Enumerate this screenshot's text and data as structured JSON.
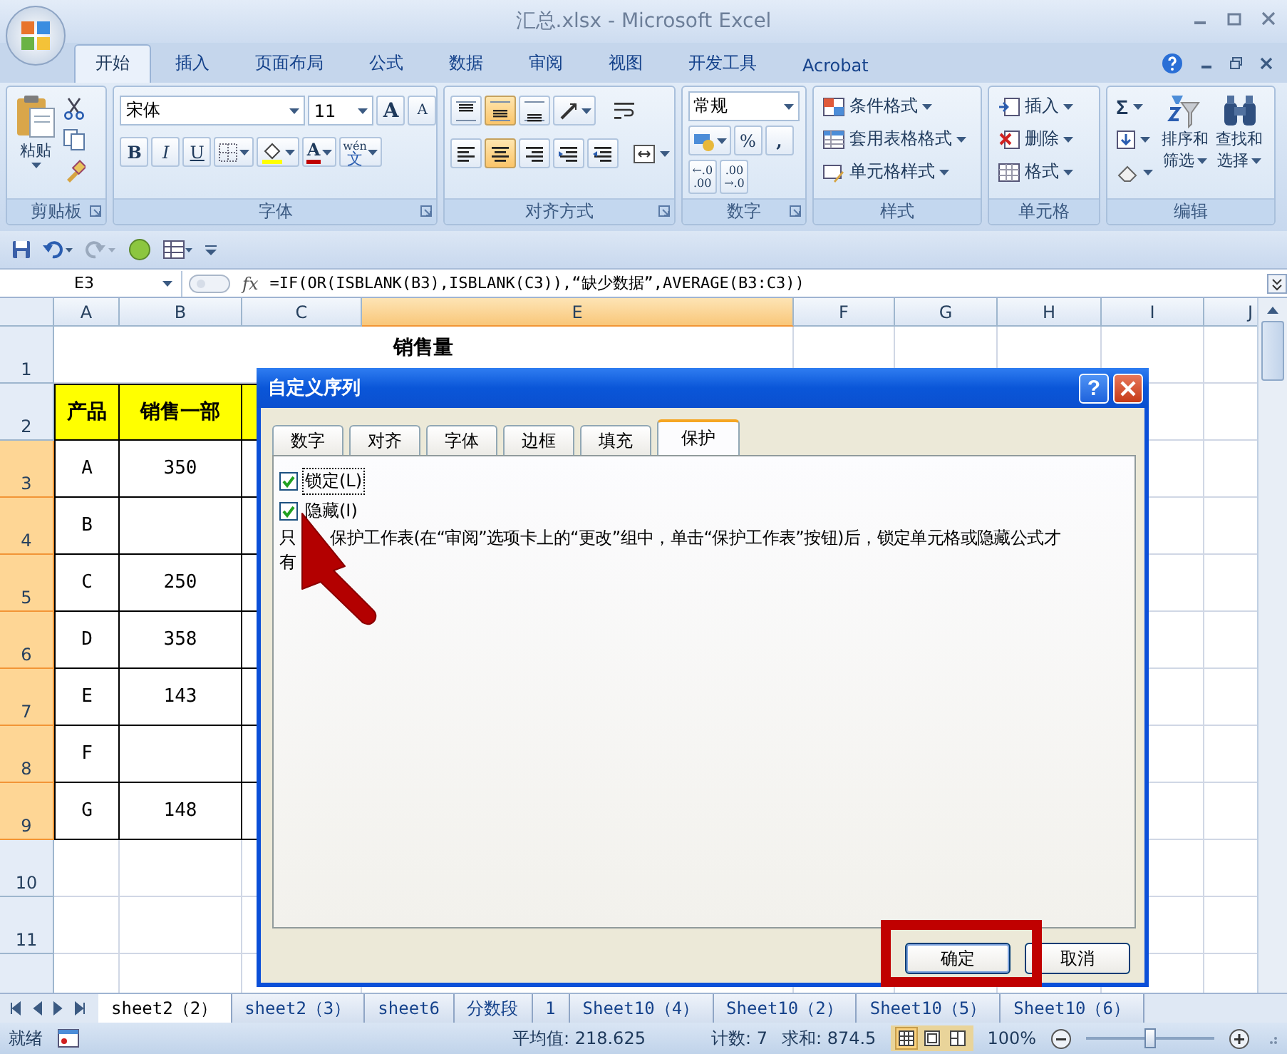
{
  "window": {
    "title": "汇总.xlsx - Microsoft Excel"
  },
  "ribbon": {
    "tabs": [
      {
        "label": "开始",
        "selected": true
      },
      {
        "label": "插入",
        "selected": false
      },
      {
        "label": "页面布局",
        "selected": false
      },
      {
        "label": "公式",
        "selected": false
      },
      {
        "label": "数据",
        "selected": false
      },
      {
        "label": "审阅",
        "selected": false
      },
      {
        "label": "视图",
        "selected": false
      },
      {
        "label": "开发工具",
        "selected": false
      },
      {
        "label": "Acrobat",
        "selected": false
      }
    ],
    "groups": [
      {
        "kind": "clipboard",
        "label": "剪贴板",
        "paste": "粘贴"
      },
      {
        "kind": "font",
        "label": "字体",
        "font": "宋体",
        "size": "11",
        "grow": "A",
        "shrink": "A",
        "bold": "B",
        "italic": "I",
        "underline": "U",
        "font_color": "A",
        "phonetic": [
          "wén",
          "文"
        ]
      },
      {
        "kind": "alignment",
        "label": "对齐方式",
        "vertical": [
          {
            "selected": false
          },
          {
            "selected": true
          },
          {
            "selected": false
          }
        ],
        "horizontal": [
          {
            "selected": false
          },
          {
            "selected": true
          },
          {
            "selected": false
          }
        ]
      },
      {
        "kind": "number",
        "label": "数字",
        "format": "常规",
        "percent": "%",
        "comma": ",",
        "increase_decimal": [
          "←.0",
          ".00"
        ],
        "decrease_decimal": [
          ".00",
          "→.0"
        ]
      },
      {
        "kind": "styles",
        "label": "样式",
        "items": [
          "条件格式",
          "套用表格格式",
          "单元格样式"
        ]
      },
      {
        "kind": "cells",
        "label": "单元格",
        "items": [
          "插入",
          "删除",
          "格式"
        ]
      },
      {
        "kind": "editing",
        "label": "编辑",
        "sum": "Σ",
        "sort": [
          "排序和",
          "筛选"
        ],
        "find": [
          "查找和",
          "选择"
        ]
      }
    ]
  },
  "formula_bar": {
    "name_box": "E3",
    "fx": "fx",
    "formula": "=IF(OR(ISBLANK(B3),ISBLANK(C3)),“缺少数据”,AVERAGE(B3:C3))"
  },
  "sheet": {
    "columns": [
      {
        "label": "A",
        "selected": false
      },
      {
        "label": "B",
        "selected": false
      },
      {
        "label": "C",
        "selected": false
      },
      {
        "label": "E",
        "selected": true
      },
      {
        "label": "F",
        "selected": false
      },
      {
        "label": "G",
        "selected": false
      },
      {
        "label": "H",
        "selected": false
      },
      {
        "label": "I",
        "selected": false
      },
      {
        "label": "J",
        "selected": false
      }
    ],
    "rows": [
      {
        "label": "1",
        "selected": false
      },
      {
        "label": "2",
        "selected": false
      },
      {
        "label": "3",
        "selected": true
      },
      {
        "label": "4",
        "selected": true
      },
      {
        "label": "5",
        "selected": true
      },
      {
        "label": "6",
        "selected": true
      },
      {
        "label": "7",
        "selected": true
      },
      {
        "label": "8",
        "selected": true
      },
      {
        "label": "9",
        "selected": true
      },
      {
        "label": "10",
        "selected": false
      },
      {
        "label": "11",
        "selected": false
      }
    ]
  },
  "table": {
    "title": "销售量",
    "headers": [
      "产品",
      "销售一部"
    ],
    "rows": [
      {
        "product": "A",
        "sales": "350"
      },
      {
        "product": "B"
      },
      {
        "product": "C",
        "sales": "250"
      },
      {
        "product": "D",
        "sales": "358"
      },
      {
        "product": "E",
        "sales": "143"
      },
      {
        "product": "F"
      },
      {
        "product": "G",
        "sales": "148"
      }
    ]
  },
  "dialog": {
    "title": "自定义序列",
    "help": "?",
    "tabs": [
      {
        "label": "数字",
        "selected": false
      },
      {
        "label": "对齐",
        "selected": false
      },
      {
        "label": "字体",
        "selected": false
      },
      {
        "label": "边框",
        "selected": false
      },
      {
        "label": "填充",
        "selected": false
      },
      {
        "label": "保护",
        "selected": true
      }
    ],
    "checkboxes": [
      {
        "label": "锁定(L)",
        "checked": true,
        "focused": true
      },
      {
        "label": "隐藏(I)",
        "checked": true,
        "focused": false
      }
    ],
    "note": [
      [
        "只",
        "保护工作表(在“审阅”选项卡上的“更改”组中，单击“保护工作表”按钮)后，锁定单元格或隐藏公式才"
      ],
      [
        "有"
      ]
    ],
    "buttons": [
      {
        "label": "确定",
        "default": true
      },
      {
        "label": "取消",
        "default": false
      }
    ]
  },
  "sheet_tabs": [
    {
      "label": "sheet2（2）",
      "selected": true
    },
    {
      "label": "sheet2（3）",
      "selected": false
    },
    {
      "label": "sheet6",
      "selected": false
    },
    {
      "label": "分数段",
      "selected": false
    },
    {
      "label": "1",
      "selected": false
    },
    {
      "label": "Sheet10（4）",
      "selected": false
    },
    {
      "label": "Sheet10（2）",
      "selected": false
    },
    {
      "label": "Sheet10（5）",
      "selected": false
    },
    {
      "label": "Sheet10（6）",
      "selected": false
    }
  ],
  "status_bar": {
    "mode": "就绪",
    "average": "平均值: 218.625",
    "count": "计数: 7",
    "sum": "求和: 874.5",
    "views": [
      {
        "selected": true
      },
      {
        "selected": false
      },
      {
        "selected": false
      }
    ],
    "zoom": {
      "label": "100%",
      "level": 0.5
    }
  }
}
